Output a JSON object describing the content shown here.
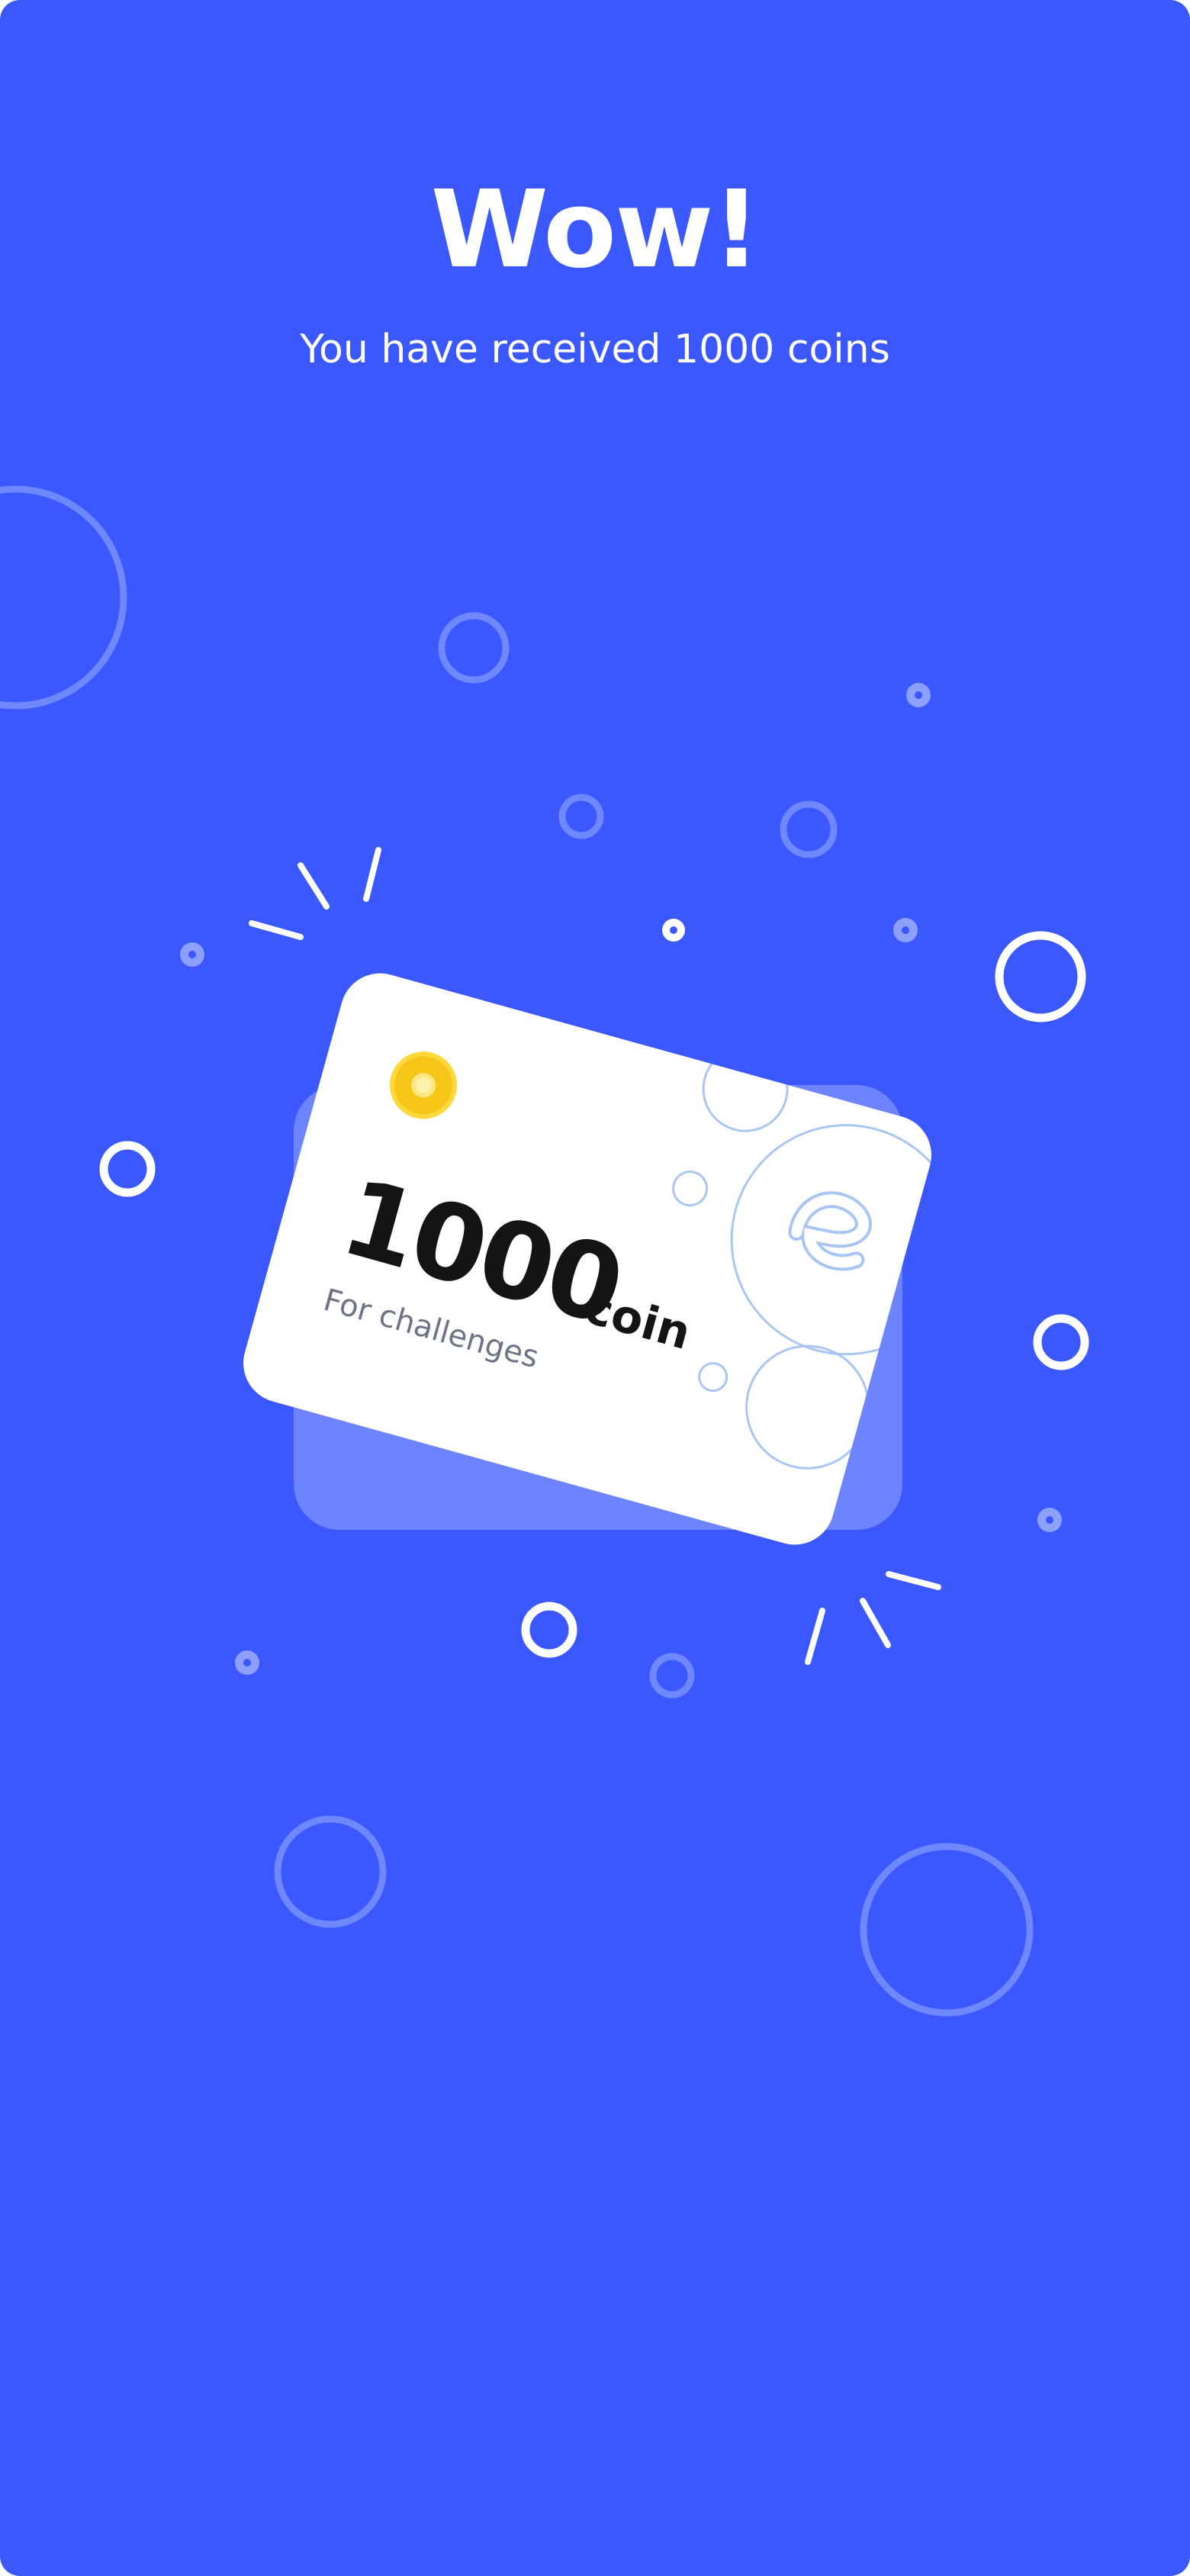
{
  "screen": {
    "title": "Wow!",
    "subtitle": "You have received 1000 coins"
  },
  "card": {
    "amount": "1000",
    "unit": "coin",
    "caption": "For challenges",
    "coin_icon": "coin-icon",
    "logo_icon": "e-logo-icon"
  },
  "colors": {
    "background": "#3a58fe",
    "card": "#ffffff",
    "coin": "#f5c518",
    "decor_faint": "#6f87ff",
    "decor_line": "#a9c6f2"
  }
}
